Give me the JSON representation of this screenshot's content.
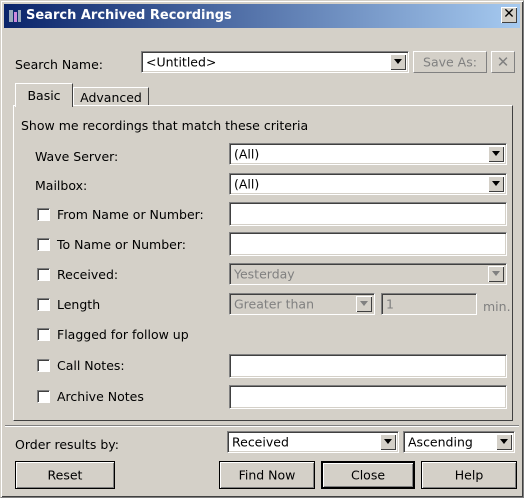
{
  "window": {
    "title": "Search Archived Recordings",
    "close_glyph": "✕"
  },
  "search_name": {
    "label": "Search Name:",
    "value": "<Untitled>",
    "save_as_label": "Save As:",
    "delete_glyph": "✕"
  },
  "tabs": [
    {
      "label": "Basic",
      "selected": true
    },
    {
      "label": "Advanced",
      "selected": false
    }
  ],
  "criteria": {
    "heading": "Show me recordings that match these criteria",
    "wave_server": {
      "label": "Wave Server:",
      "value": "(All)"
    },
    "mailbox": {
      "label": "Mailbox:",
      "value": "(All)"
    },
    "from_name": {
      "label": "From Name or Number:",
      "checked": false,
      "value": ""
    },
    "to_name": {
      "label": "To Name or Number:",
      "checked": false,
      "value": ""
    },
    "received": {
      "label": "Received:",
      "checked": false,
      "value": "Yesterday"
    },
    "length": {
      "label": "Length",
      "checked": false,
      "operator": "Greater than",
      "value": "1",
      "unit": "min."
    },
    "flagged": {
      "label": "Flagged for follow up",
      "checked": false
    },
    "call_notes": {
      "label": "Call Notes:",
      "checked": false,
      "value": ""
    },
    "archive_notes": {
      "label": "Archive Notes",
      "checked": false,
      "value": ""
    }
  },
  "order": {
    "label": "Order results by:",
    "field_value": "Received",
    "direction_value": "Ascending"
  },
  "buttons": {
    "reset": "Reset",
    "find_now": "Find Now",
    "close": "Close",
    "help": "Help"
  },
  "colors": {
    "title_start": "#0a246a",
    "title_end": "#a6caf0",
    "face": "#d4d0c8"
  }
}
